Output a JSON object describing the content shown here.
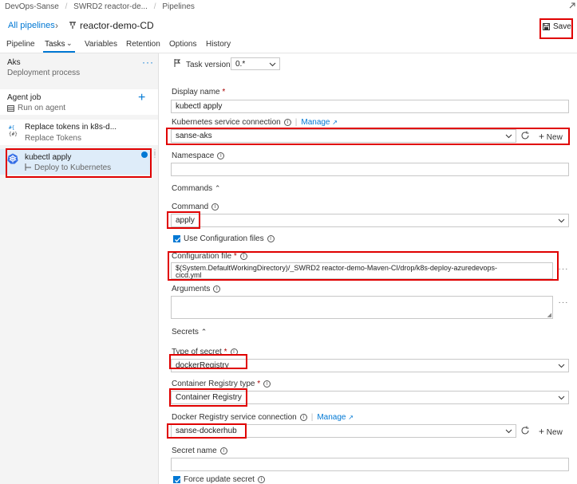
{
  "breadcrumb": {
    "org": "DevOps-Sanse",
    "project": "SWRD2 reactor-de...",
    "section": "Pipelines"
  },
  "header": {
    "all_pipelines": "All pipelines",
    "pipeline_name": "reactor-demo-CD",
    "save_label": "Save"
  },
  "tabs": [
    "Pipeline",
    "Tasks",
    "Variables",
    "Retention",
    "Options",
    "History"
  ],
  "sidebar": {
    "stage_name": "Aks",
    "stage_sub": "Deployment process",
    "agent_job": "Agent job",
    "agent_sub": "Run on agent",
    "tasks": [
      {
        "name": "Replace tokens in k8s-d...",
        "sub": "Replace Tokens"
      },
      {
        "name": "kubectl apply",
        "sub": "Deploy to Kubernetes"
      }
    ]
  },
  "form": {
    "task_version_label": "Task version",
    "task_version_value": "0.*",
    "display_name_label": "Display name",
    "display_name_value": "kubectl apply",
    "k8s_conn_label": "Kubernetes service connection",
    "manage_label": "Manage",
    "k8s_conn_value": "sanse-aks",
    "new_label": "New",
    "namespace_label": "Namespace",
    "commands_section": "Commands",
    "command_label": "Command",
    "command_value": "apply",
    "use_config_label": "Use Configuration files",
    "config_file_label": "Configuration file",
    "config_file_value_line1": "$(System.DefaultWorkingDirectory)/_SWRD2 reactor-demo-Maven-CI/drop/k8s-deploy-azuredevops-",
    "config_file_value_line2": "cicd.yml",
    "arguments_label": "Arguments",
    "secrets_section": "Secrets",
    "type_of_secret_label": "Type of secret",
    "type_of_secret_value": "dockerRegistry",
    "container_reg_type_label": "Container Registry type",
    "container_reg_type_value": "Container Registry",
    "docker_conn_label": "Docker Registry service connection",
    "docker_conn_value": "sanse-dockerhub",
    "secret_name_label": "Secret name",
    "force_update_label": "Force update secret"
  },
  "colors": {
    "accent": "#0078d4",
    "highlight": "#e00000",
    "selected_bg": "#deecf9"
  }
}
